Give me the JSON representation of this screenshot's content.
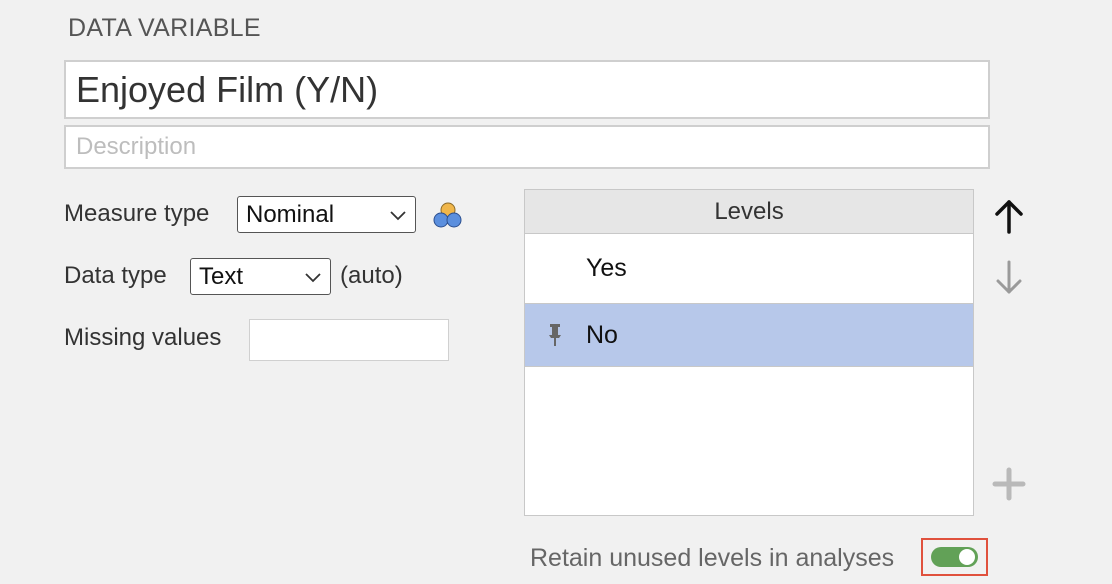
{
  "section_title": "DATA VARIABLE",
  "variable": {
    "name": "Enjoyed Film (Y/N)",
    "description_placeholder": "Description",
    "description_value": ""
  },
  "measure_type": {
    "label": "Measure type",
    "selected": "Nominal",
    "icon": "nominal-icon"
  },
  "data_type": {
    "label": "Data type",
    "selected": "Text",
    "auto_label": "(auto)"
  },
  "missing_values": {
    "label": "Missing values",
    "value": ""
  },
  "levels": {
    "header": "Levels",
    "items": [
      {
        "label": "Yes",
        "selected": false,
        "pinned": false
      },
      {
        "label": "No",
        "selected": true,
        "pinned": true
      }
    ]
  },
  "controls": {
    "move_up_icon": "arrow-up-icon",
    "move_down_icon": "arrow-down-icon",
    "add_icon": "plus-icon"
  },
  "retain_unused": {
    "label": "Retain unused levels in analyses",
    "enabled": true
  },
  "colors": {
    "selected_row": "#b7c8ea",
    "toggle_on": "#62a157",
    "highlight_frame": "#e0513d"
  }
}
